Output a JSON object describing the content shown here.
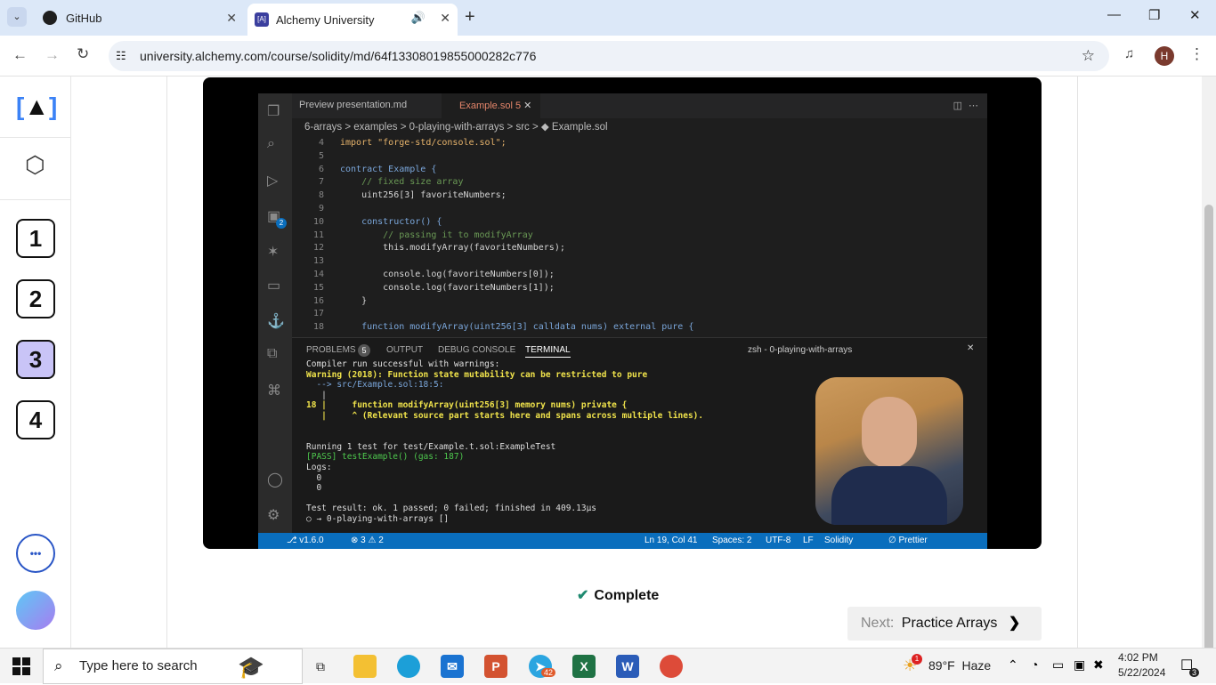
{
  "browser": {
    "tabs": [
      {
        "title": "GitHub",
        "active": false
      },
      {
        "title": "Alchemy University",
        "active": true
      }
    ],
    "url": "university.alchemy.com/course/solidity/md/64f13308019855000282c776",
    "profile_initial": "H"
  },
  "sidebar": {
    "steps": [
      "1",
      "2",
      "3",
      "4"
    ],
    "selected_step": "3",
    "more_label": "•••"
  },
  "video": {
    "editor_tabs": [
      {
        "label": "Preview presentation.md"
      },
      {
        "label": "Example.sol 5"
      }
    ],
    "breadcrumb": "6-arrays > examples > 0-playing-with-arrays > src > ◆ Example.sol",
    "code_lines": [
      {
        "n": "4",
        "text": "import \"forge-std/console.sol\";"
      },
      {
        "n": "5",
        "text": ""
      },
      {
        "n": "6",
        "text": "contract Example {"
      },
      {
        "n": "7",
        "text": "    // fixed size array"
      },
      {
        "n": "8",
        "text": "    uint256[3] favoriteNumbers;"
      },
      {
        "n": "9",
        "text": ""
      },
      {
        "n": "10",
        "text": "    constructor() {"
      },
      {
        "n": "11",
        "text": "        // passing it to modifyArray"
      },
      {
        "n": "12",
        "text": "        this.modifyArray(favoriteNumbers);"
      },
      {
        "n": "13",
        "text": ""
      },
      {
        "n": "14",
        "text": "        console.log(favoriteNumbers[0]);"
      },
      {
        "n": "15",
        "text": "        console.log(favoriteNumbers[1]);"
      },
      {
        "n": "16",
        "text": "    }"
      },
      {
        "n": "17",
        "text": ""
      },
      {
        "n": "18",
        "text": "    function modifyArray(uint256[3] calldata nums) external pure {"
      }
    ],
    "panel_tabs": {
      "problems": "PROBLEMS",
      "problems_count": "5",
      "output": "OUTPUT",
      "debug": "DEBUG CONSOLE",
      "terminal": "TERMINAL",
      "shell": "zsh - 0-playing-with-arrays"
    },
    "terminal_lines": [
      "Compiler run successful with warnings:",
      "Warning (2018): Function state mutability can be restricted to pure",
      "  --> src/Example.sol:18:5:",
      "   |",
      "18 |     function modifyArray(uint256[3] memory nums) private {",
      "   |     ^ (Relevant source part starts here and spans across multiple lines).",
      "",
      "",
      "Running 1 test for test/Example.t.sol:ExampleTest",
      "[PASS] testExample() (gas: 187)",
      "Logs:",
      "  0",
      "  0",
      "",
      "Test result: ok. 1 passed; 0 failed; finished in 409.13µs",
      "○ → 0-playing-with-arrays []"
    ],
    "status_bar": {
      "left": "⎇ v1.6.0",
      "errors": "⊗ 3 ⚠ 2",
      "position": "Ln 19, Col 41",
      "spaces": "Spaces: 2",
      "encoding": "UTF-8",
      "eol": "LF",
      "language": "Solidity",
      "formatter": "∅ Prettier"
    },
    "activity_badge": "2"
  },
  "lesson": {
    "complete_label": "Complete",
    "next_prefix": "Next:",
    "next_title": "Practice Arrays"
  },
  "taskbar": {
    "search_placeholder": "Type here to search",
    "weather": "89°F  Haze",
    "weather_badge": "1",
    "time": "4:02 PM",
    "date": "5/22/2024",
    "telegram_badge": "42",
    "notification_count": "3"
  },
  "colors": {
    "accent_purple": "#c9c4f7",
    "vscode_status": "#0a6ebd",
    "complete_check": "#1f8a70"
  }
}
